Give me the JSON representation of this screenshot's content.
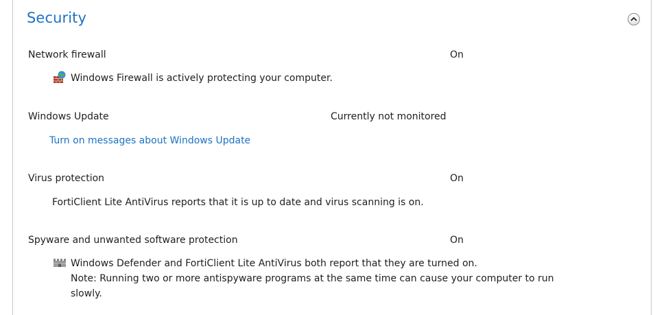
{
  "section": {
    "title": "Security"
  },
  "rows": {
    "firewall": {
      "label": "Network firewall",
      "status": "On",
      "detail": "Windows Firewall is actively protecting your computer.",
      "icon": "firewall-icon"
    },
    "update": {
      "label": "Windows Update",
      "status": "Currently not monitored",
      "link": "Turn on messages about Windows Update"
    },
    "virus": {
      "label": "Virus protection",
      "status": "On",
      "detail": "FortiClient Lite AntiVirus reports that it is up to date and virus scanning is on."
    },
    "spyware": {
      "label": "Spyware and unwanted software protection",
      "status": "On",
      "detail_line1": "Windows Defender and FortiClient Lite AntiVirus both report that they are turned on.",
      "detail_line2": "Note: Running two or more antispyware programs at the same time can cause your computer to run",
      "detail_line3": "slowly.",
      "icon": "defender-castle-icon"
    }
  },
  "colors": {
    "accent": "#1c72c4",
    "text": "#1e1e1e",
    "border": "#c8c8c8"
  }
}
